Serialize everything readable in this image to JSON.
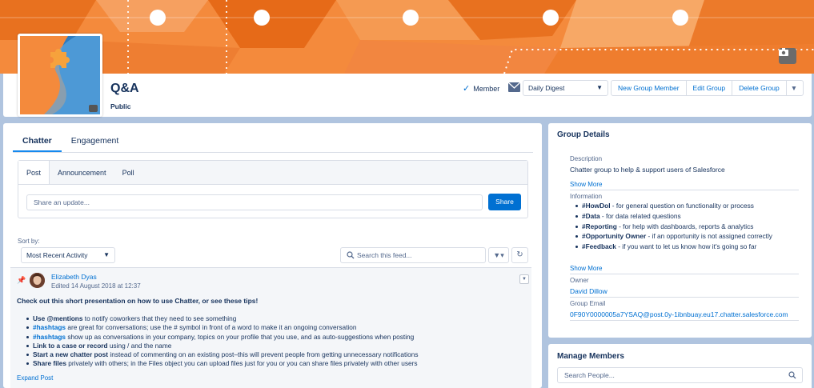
{
  "group": {
    "title": "Q&A",
    "visibility": "Public"
  },
  "header_actions": {
    "member_label": "Member",
    "digest_value": "Daily Digest",
    "new_member_label": "New Group Member",
    "edit_label": "Edit Group",
    "delete_label": "Delete Group"
  },
  "tabs": [
    {
      "label": "Chatter",
      "active": true
    },
    {
      "label": "Engagement",
      "active": false
    }
  ],
  "publisher": {
    "tabs": [
      {
        "label": "Post",
        "active": true
      },
      {
        "label": "Announcement",
        "active": false
      },
      {
        "label": "Poll",
        "active": false
      }
    ],
    "placeholder": "Share an update...",
    "share_label": "Share"
  },
  "feed": {
    "sort_label": "Sort by:",
    "sort_value": "Most Recent Activity",
    "search_placeholder": "Search this feed..."
  },
  "post": {
    "author": "Elizabeth Dyas",
    "meta": "Edited 14 August 2018 at 12:37",
    "lead": "Check out this short presentation on how to use Chatter, or see these tips!",
    "tips": [
      {
        "strong": "Use @mentions",
        "rest": " to notify coworkers that they need to see something"
      },
      {
        "tag": "#hashtags",
        "rest": " are great for conversations; use the # symbol in front of a word to make it an ongoing conversation"
      },
      {
        "tag": "#hashtags",
        "rest": " show up as conversations in your company, topics on your profile that you use, and as auto-suggestions when posting"
      },
      {
        "strong": "Link to a case or record",
        "rest": " using / and the name"
      },
      {
        "strong": "Start a new chatter post",
        "rest": " instead of commenting on an existing post–this will prevent people from getting unnecessary notifications"
      },
      {
        "strong": "Share files",
        "rest": " privately with others; in the Files object you can upload files just for you or you can share files privately with other users"
      }
    ],
    "expand_label": "Expand Post"
  },
  "details": {
    "title": "Group Details",
    "description_label": "Description",
    "description": "Chatter group to help & support users of Salesforce",
    "show_more_1": "Show More",
    "information_label": "Information",
    "info_items": [
      {
        "tag": "#HowDoI",
        "rest": " - for general question on functionality or process"
      },
      {
        "tag": "#Data",
        "rest": " - for data related questions"
      },
      {
        "tag": "#Reporting",
        "rest": " - for help with dashboards, reports & analytics"
      },
      {
        "tag": "#Opportunity Owner",
        "rest": " - if an opportunity is not assigned correctly"
      },
      {
        "tag": "#Feedback",
        "rest": " - if you want to let us know how it's going so far"
      }
    ],
    "show_more_2": "Show More",
    "owner_label": "Owner",
    "owner": "David Dillow",
    "email_label": "Group Email",
    "email": "0F90Y0000005a7YSAQ@post.0y-1ibnbuay.eu17.chatter.salesforce.com"
  },
  "members": {
    "title": "Manage Members",
    "search_placeholder": "Search People..."
  },
  "colors": {
    "banner": "#f48a3c",
    "banner_dark": "#e06a1c",
    "brand": "#0070d2",
    "text": "#16325c",
    "background": "#b0c4df"
  }
}
